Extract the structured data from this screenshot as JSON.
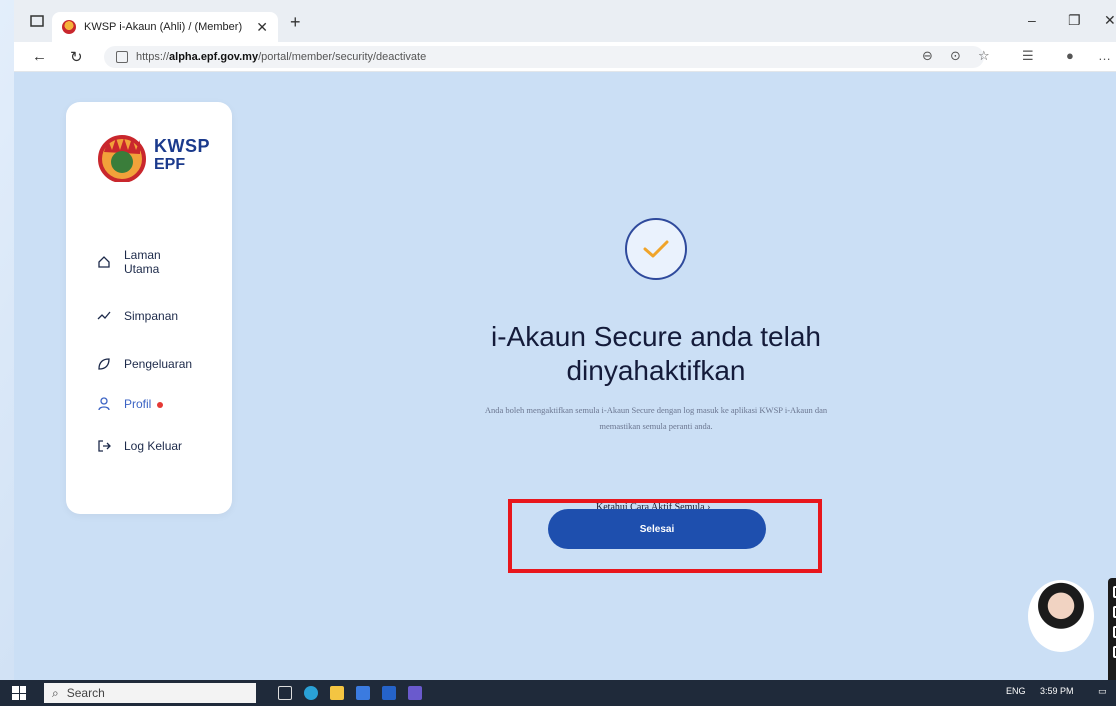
{
  "browser": {
    "tab_title": "KWSP i-Akaun (Ahli) / (Member)",
    "url_prefix": "https://",
    "url_domain": "alpha.epf.gov.my",
    "url_path": "/portal/member/security/deactivate"
  },
  "sidebar": {
    "logo": {
      "line1": "KWSP",
      "line2": "EPF"
    },
    "items": [
      {
        "label": "Laman Utama",
        "icon": "home-icon"
      },
      {
        "label": "Simpanan",
        "icon": "trend-icon"
      },
      {
        "label": "Pengeluaran",
        "icon": "leaf-icon"
      },
      {
        "label": "Profil",
        "icon": "user-icon",
        "active": true
      },
      {
        "label": "Log Keluar",
        "icon": "logout-icon"
      }
    ]
  },
  "main": {
    "headline": "i-Akaun Secure anda telah dinyahaktifkan",
    "subtext": "Anda boleh mengaktifkan semula i-Akaun Secure dengan log masuk ke aplikasi KWSP i-Akaun dan memastikan semula peranti anda.",
    "learn_link": "Ketahui Cara Aktif Semula",
    "done_button": "Selesai"
  },
  "taskbar": {
    "search": "Search",
    "lang": "ENG",
    "time": "3:59 PM"
  },
  "colors": {
    "page_bg": "#cbdff5",
    "primary_button": "#1e4fae",
    "highlight_border": "#e8161c",
    "logo_blue": "#1b3a8c"
  }
}
